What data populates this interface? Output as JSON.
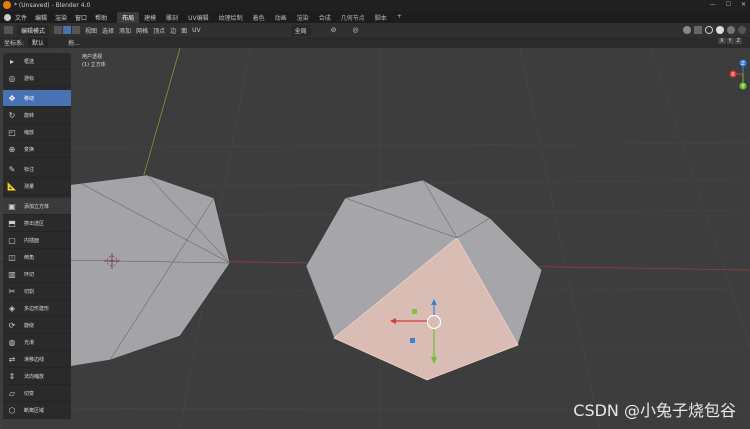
{
  "app": {
    "title": "* (Unsaved) - Blender 4.0"
  },
  "menu": {
    "items": [
      "文件",
      "编辑",
      "渲染",
      "窗口",
      "帮助"
    ]
  },
  "workspaces": [
    {
      "label": "布局",
      "active": true
    },
    {
      "label": "建模"
    },
    {
      "label": "雕刻"
    },
    {
      "label": "UV编辑"
    },
    {
      "label": "纹理绘制"
    },
    {
      "label": "着色"
    },
    {
      "label": "动画"
    },
    {
      "label": "渲染"
    },
    {
      "label": "合成"
    },
    {
      "label": "几何节点"
    },
    {
      "label": "脚本"
    },
    {
      "label": "+"
    }
  ],
  "header": {
    "mode": "编辑模式",
    "menus": [
      "视图",
      "选择",
      "添加",
      "网格",
      "顶点",
      "边",
      "面",
      "UV"
    ],
    "orientation": "全局"
  },
  "toolsettings": {
    "coord_label": "坐标系:",
    "coord_value": "默认",
    "drag_label": "拖..."
  },
  "viewport": {
    "view_name": "用户透视",
    "object_name": "(1) 立方体"
  },
  "tools": [
    {
      "label": "框选",
      "icon": "select-box-icon"
    },
    {
      "label": "游标",
      "icon": "cursor-icon"
    },
    {
      "label": "移动",
      "icon": "move-icon",
      "active": true
    },
    {
      "label": "旋转",
      "icon": "rotate-icon"
    },
    {
      "label": "缩放",
      "icon": "scale-icon"
    },
    {
      "label": "变换",
      "icon": "transform-icon"
    },
    {
      "label": "标注",
      "icon": "annotate-icon"
    },
    {
      "label": "测量",
      "icon": "measure-icon"
    },
    {
      "label": "添加立方体",
      "icon": "add-cube-icon",
      "hl": true
    },
    {
      "label": "挤出选区",
      "icon": "extrude-icon"
    },
    {
      "label": "内插面",
      "icon": "inset-icon"
    },
    {
      "label": "倒角",
      "icon": "bevel-icon"
    },
    {
      "label": "环切",
      "icon": "loop-cut-icon"
    },
    {
      "label": "切割",
      "icon": "knife-icon"
    },
    {
      "label": "多边形建形",
      "icon": "poly-build-icon"
    },
    {
      "label": "旋绕",
      "icon": "spin-icon"
    },
    {
      "label": "光滑",
      "icon": "smooth-icon"
    },
    {
      "label": "滑移边线",
      "icon": "edge-slide-icon"
    },
    {
      "label": "法向缩放",
      "icon": "shrink-fatten-icon"
    },
    {
      "label": "切变",
      "icon": "shear-icon"
    },
    {
      "label": "断离区域",
      "icon": "rip-region-icon"
    }
  ],
  "gizmo": {
    "z": "Z",
    "x": "X",
    "y": "Y"
  },
  "watermark": "CSDN @小兔子烧包谷",
  "colors": {
    "accent": "#4772b3",
    "selection_face": "#d9bcb3"
  }
}
